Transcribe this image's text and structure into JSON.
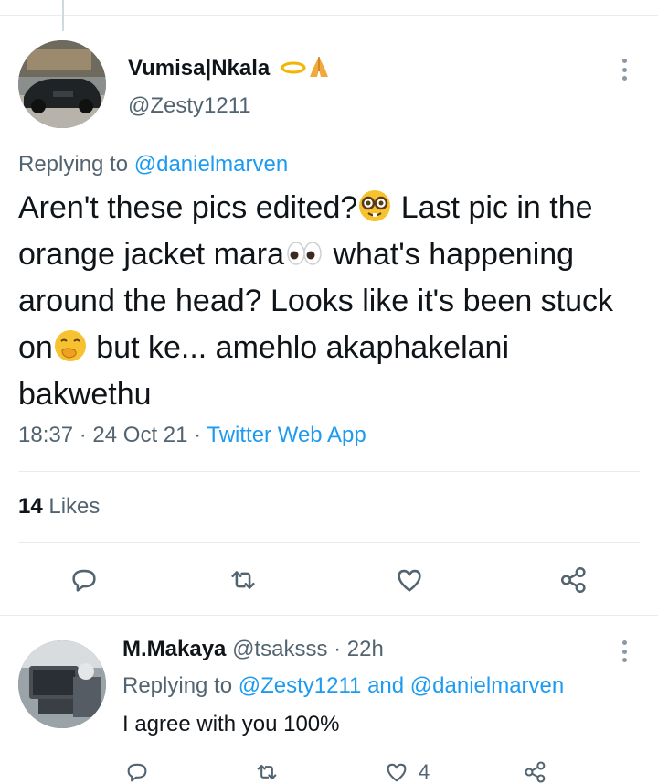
{
  "main_tweet": {
    "display_name": "Vumisa|Nkala",
    "name_emojis": [
      "halo-emoji",
      "folded-hands-emoji"
    ],
    "handle": "@Zesty1211",
    "replying_prefix": "Replying to",
    "replying_to": "@danielmarven",
    "text_parts": [
      "Aren't these pics edited?",
      " Last pic in the orange jacket mara",
      " what's happening around the head? Looks like it's been stuck on",
      " but ke... amehlo akaphakelani bakwethu"
    ],
    "time": "18:37",
    "date": "24 Oct 21",
    "app": "Twitter Web App",
    "sep": "·",
    "likes_count": "14",
    "likes_label": "Likes"
  },
  "reply_tweet": {
    "display_name": "M.Makaya",
    "handle": "@tsaksss",
    "sep": "·",
    "age": "22h",
    "replying_prefix": "Replying to",
    "replying_to_1": "@Zesty1211",
    "and": "and",
    "replying_to_2": "@danielmarven",
    "text": "I agree with you 100%",
    "like_count": "4"
  },
  "icons": [
    "reply-icon",
    "retweet-icon",
    "like-icon",
    "share-icon",
    "more-icon"
  ],
  "colors": {
    "accent": "#1d9bf0",
    "secondary_text": "#536471",
    "primary_text": "#0f1419",
    "divider": "#e6ecf0"
  }
}
